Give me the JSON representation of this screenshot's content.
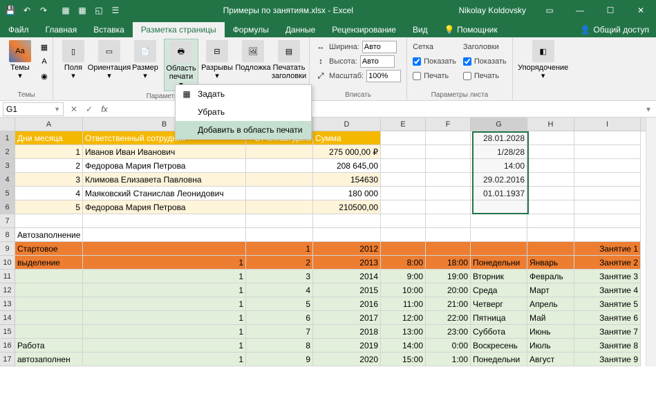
{
  "titlebar": {
    "title": "Примеры по занятиям.xlsx - Excel",
    "user": "Nikolay Koldovsky"
  },
  "tabs": {
    "file": "Файл",
    "home": "Главная",
    "insert": "Вставка",
    "pagelayout": "Разметка страницы",
    "formulas": "Формулы",
    "data": "Данные",
    "review": "Рецензирование",
    "view": "Вид",
    "tellme": "Помощник",
    "share": "Общий доступ"
  },
  "ribbon": {
    "themes": {
      "themes": "Темы",
      "group": "Темы"
    },
    "pagesetup": {
      "margins": "Поля",
      "orientation": "Ориентация",
      "size": "Размер",
      "printarea": "Область печати",
      "breaks": "Разрывы",
      "background": "Подложка",
      "printtitles": "Печатать заголовки",
      "group": "Параметры страницы"
    },
    "scale": {
      "width_lbl": "Ширина:",
      "width_val": "Авто",
      "height_lbl": "Высота:",
      "height_val": "Авто",
      "scale_lbl": "Масштаб:",
      "scale_val": "100%",
      "group": "Вписать"
    },
    "sheetopts": {
      "grid": "Сетка",
      "headings": "Заголовки",
      "show": "Показать",
      "print": "Печать",
      "group": "Параметры листа"
    },
    "arrange": {
      "btn": "Упорядочение"
    }
  },
  "dropdown": {
    "set": "Задать",
    "clear": "Убрать",
    "add": "Добавить в область печати"
  },
  "namebox": "G1",
  "cols": [
    "A",
    "B",
    "C",
    "D",
    "E",
    "F",
    "G",
    "H",
    "I"
  ],
  "headers": {
    "a": "Дни месяца",
    "b": "Ответственный сотрудник",
    "c": "Отчетная дата",
    "d": "Сумма"
  },
  "data_rows": [
    {
      "n": "1",
      "a": "1",
      "b": "Иванов Иван Иванович",
      "d": "275 000,00 ₽",
      "g": "28.01.2028"
    },
    {
      "n": "2",
      "a": "2",
      "b": "Федорова Мария Петрова",
      "d": "208 645,00",
      "g": "1/28/28"
    },
    {
      "n": "3",
      "a": "3",
      "b": "Климова Елизавета Павловна",
      "d": "154630",
      "g": "14:00"
    },
    {
      "n": "4",
      "a": "4",
      "b": "Маяковский Станислав Леонидович",
      "d": "180 000",
      "g": "29.02.2016"
    },
    {
      "n": "5",
      "a": "5",
      "b": "Федорова Мария Петрова",
      "d": "210500,00",
      "g": "01.01.1937"
    }
  ],
  "autofill_label": "Автозаполнение",
  "block2": {
    "r9": {
      "a": "Стартовое",
      "c": "1",
      "d": "2012",
      "i": "Занятие 1"
    },
    "r10": {
      "a": "выделение",
      "b": "1",
      "c": "2",
      "d": "2013",
      "e": "8:00",
      "f": "18:00",
      "g": "Понедельни",
      "h": "Январь",
      "i": "Занятие 2"
    },
    "r11": {
      "b": "1",
      "c": "3",
      "d": "2014",
      "e": "9:00",
      "f": "19:00",
      "g": "Вторник",
      "h": "Февраль",
      "i": "Занятие 3"
    },
    "r12": {
      "b": "1",
      "c": "4",
      "d": "2015",
      "e": "10:00",
      "f": "20:00",
      "g": "Среда",
      "h": "Март",
      "i": "Занятие 4"
    },
    "r13": {
      "b": "1",
      "c": "5",
      "d": "2016",
      "e": "11:00",
      "f": "21:00",
      "g": "Четверг",
      "h": "Апрель",
      "i": "Занятие 5"
    },
    "r14": {
      "b": "1",
      "c": "6",
      "d": "2017",
      "e": "12:00",
      "f": "22:00",
      "g": "Пятница",
      "h": "Май",
      "i": "Занятие 6"
    },
    "r15": {
      "b": "1",
      "c": "7",
      "d": "2018",
      "e": "13:00",
      "f": "23:00",
      "g": "Суббота",
      "h": "Июнь",
      "i": "Занятие 7"
    },
    "r16": {
      "a": "Работа",
      "b": "1",
      "c": "8",
      "d": "2019",
      "e": "14:00",
      "f": "0:00",
      "g": "Воскресень",
      "h": "Июль",
      "i": "Занятие 8"
    },
    "r17": {
      "a": "автозаполнен",
      "b": "1",
      "c": "9",
      "d": "2020",
      "e": "15:00",
      "f": "1:00",
      "g": "Понедельни",
      "h": "Август",
      "i": "Занятие 9"
    }
  }
}
